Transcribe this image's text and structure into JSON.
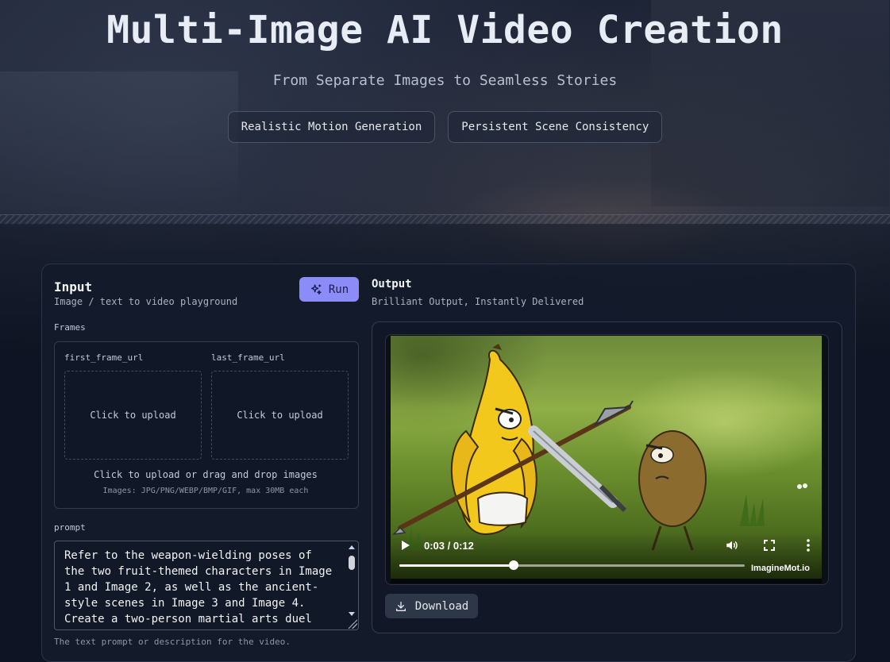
{
  "hero": {
    "title": "Multi-Image AI Video Creation",
    "subtitle": "From Separate Images to Seamless Stories",
    "badges": [
      "Realistic Motion Generation",
      "Persistent Scene Consistency"
    ]
  },
  "input": {
    "title": "Input",
    "subtitle": "Image / text to video playground",
    "run_label": "Run",
    "frames_label": "Frames",
    "first_frame_label": "first_frame_url",
    "last_frame_label": "last_frame_url",
    "first_frame_upload": "Click to upload",
    "last_frame_upload": "Click to upload",
    "upload_hint": "Click to upload or drag and drop images",
    "upload_formats": "Images: JPG/PNG/WEBP/BMP/GIF, max 30MB each",
    "prompt_label": "prompt",
    "prompt_value": "Refer to the weapon-wielding poses of the two fruit-themed characters in Image 1 and Image 2, as well as the ancient-style scenes in Image 3 and Image 4. Create a two-person martial arts duel",
    "prompt_help": "The text prompt or description for the video."
  },
  "output": {
    "title": "Output",
    "subtitle": "Brilliant Output, Instantly Delivered",
    "video": {
      "time": "0:03 / 0:12",
      "progress": 0.33,
      "watermark": "ImagineMot.io"
    },
    "download_label": "Download"
  },
  "colors": {
    "accent": "#8b8cf7",
    "background": "#0e1424",
    "panel": "#141b2b"
  },
  "icons": {
    "run": "sparkles-icon",
    "download": "download-icon",
    "play": "play-icon",
    "volume": "volume-icon",
    "fullscreen": "fullscreen-icon",
    "more": "more-vertical-icon"
  }
}
